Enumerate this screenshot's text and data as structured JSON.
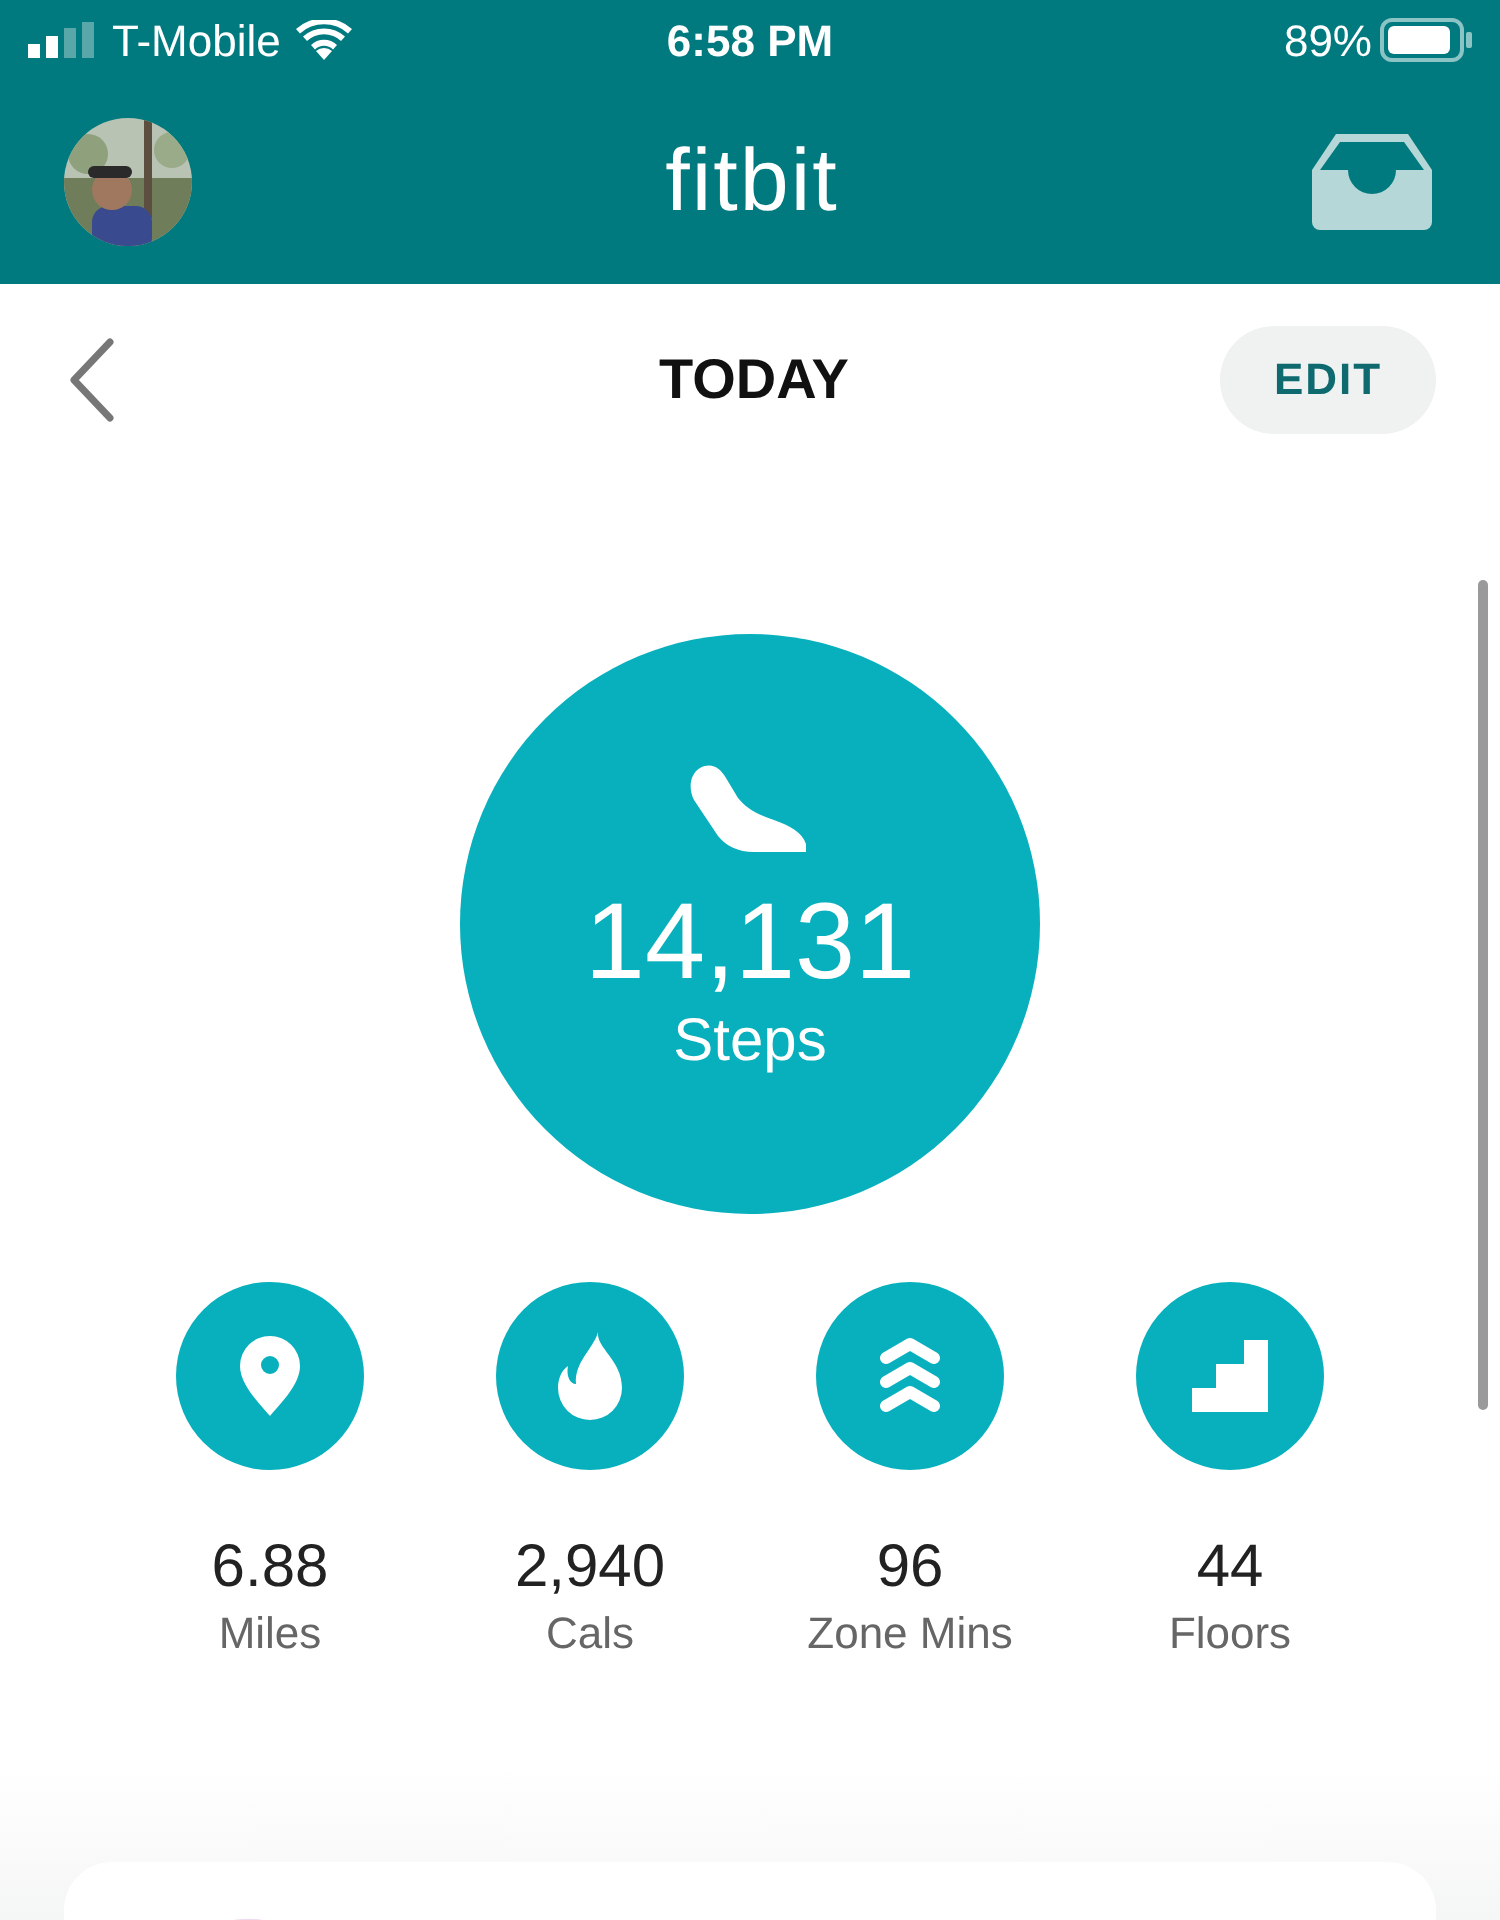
{
  "status_bar": {
    "carrier": "T-Mobile",
    "time": "6:58 PM",
    "battery": "89%"
  },
  "header": {
    "logo": "fitbit"
  },
  "nav": {
    "title": "TODAY",
    "edit": "EDIT"
  },
  "steps": {
    "value": "14,131",
    "label": "Steps"
  },
  "stats": [
    {
      "kind": "distance",
      "value": "6.88",
      "label": "Miles"
    },
    {
      "kind": "calories",
      "value": "2,940",
      "label": "Cals"
    },
    {
      "kind": "zone",
      "value": "96",
      "label": "Zone Mins"
    },
    {
      "kind": "floors",
      "value": "44",
      "label": "Floors"
    }
  ]
}
